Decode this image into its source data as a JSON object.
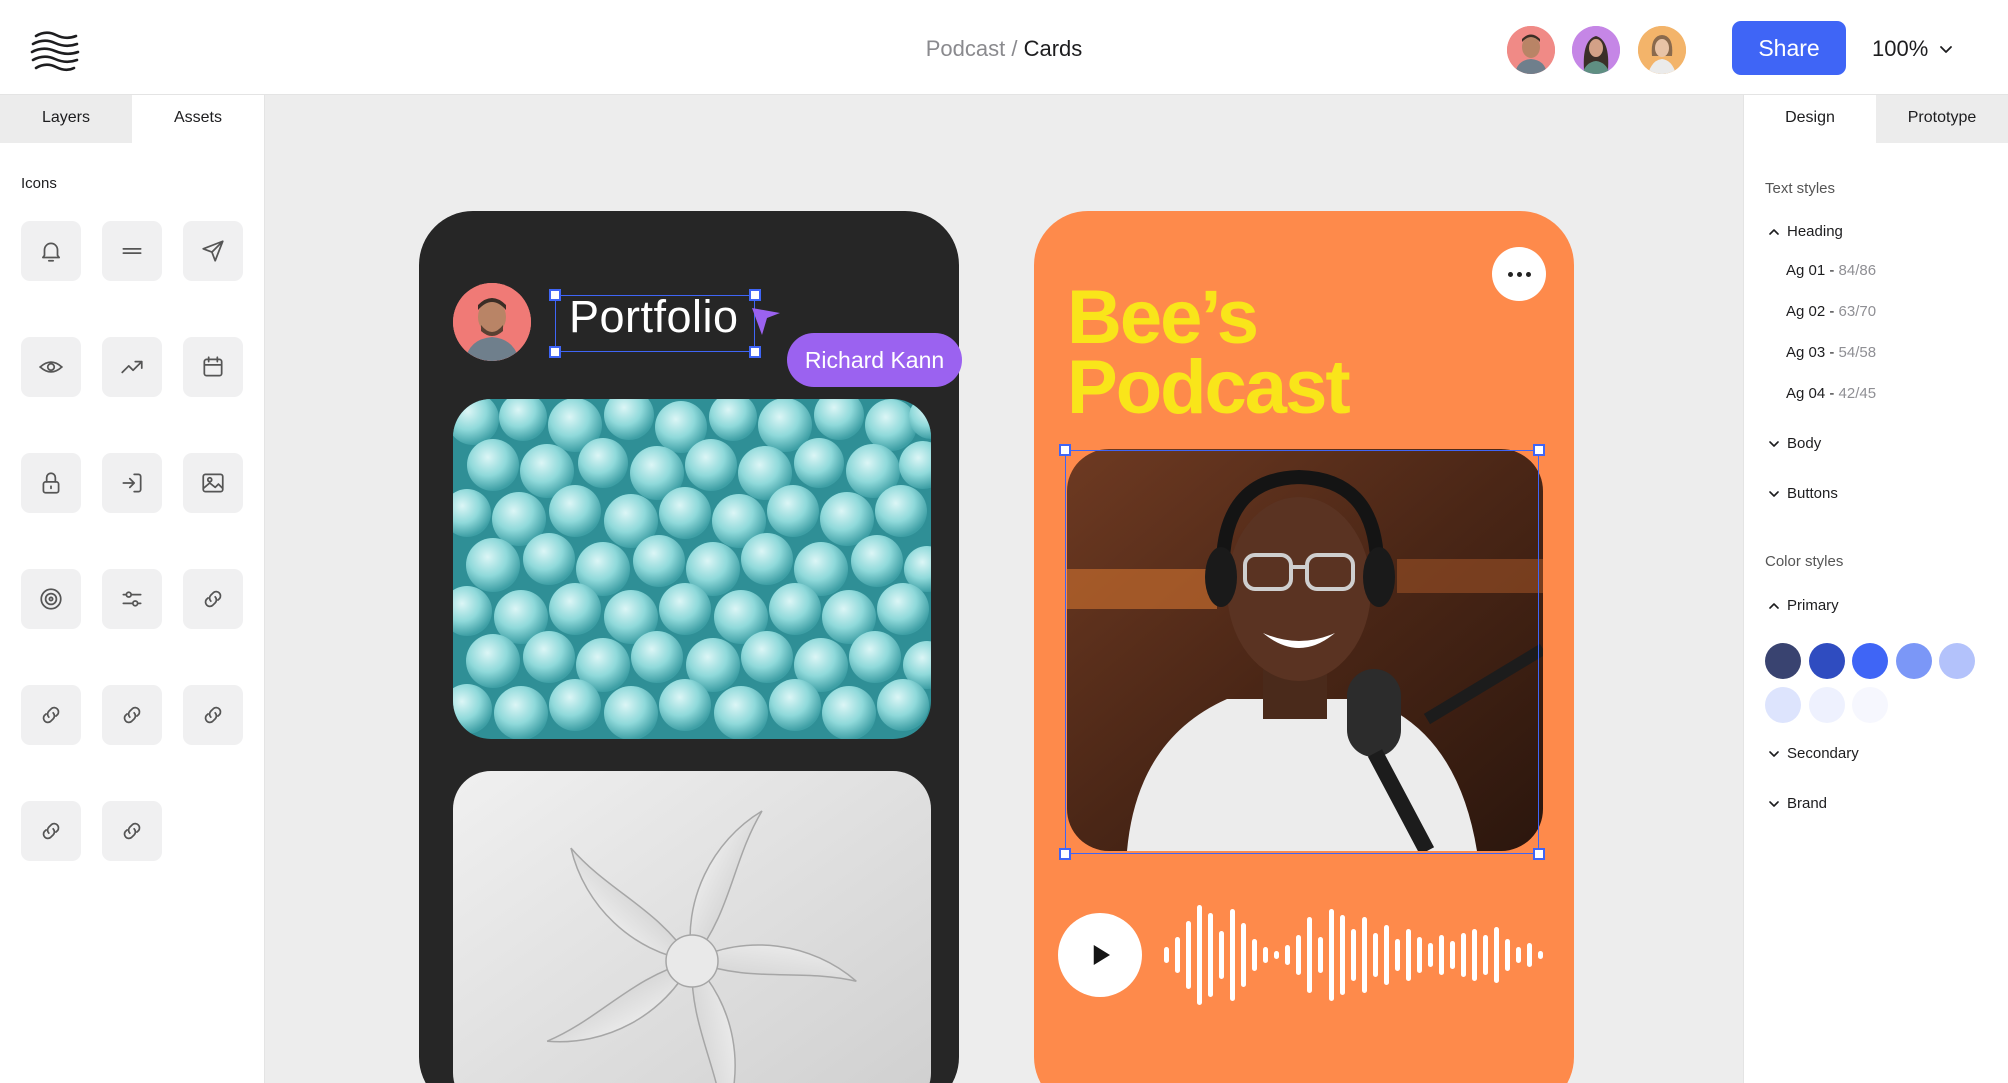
{
  "header": {
    "breadcrumb_parent": "Podcast",
    "breadcrumb_sep": " / ",
    "breadcrumb_current": "Cards",
    "share_label": "Share",
    "zoom_level": "100%"
  },
  "left_panel": {
    "tabs": [
      {
        "label": "Layers"
      },
      {
        "label": "Assets"
      }
    ],
    "active_tab": "Assets",
    "section_title": "Icons",
    "icons": [
      "bell-icon",
      "menu-icon",
      "send-icon",
      "eye-icon",
      "trending-up-icon",
      "calendar-icon",
      "lock-icon",
      "log-in-icon",
      "image-icon",
      "target-icon",
      "sliders-icon",
      "link-icon",
      "link-icon",
      "link-icon",
      "link-icon",
      "link-icon",
      "link-icon"
    ]
  },
  "right_panel": {
    "tabs": [
      {
        "label": "Design"
      },
      {
        "label": "Prototype"
      }
    ],
    "active_tab": "Design",
    "text_styles_title": "Text styles",
    "heading_group": "Heading",
    "heading_styles": [
      {
        "name": "Ag 01 - ",
        "meta": "84/86"
      },
      {
        "name": "Ag 02 - ",
        "meta": "63/70"
      },
      {
        "name": "Ag 03 - ",
        "meta": "54/58"
      },
      {
        "name": "Ag 04 - ",
        "meta": "42/45"
      }
    ],
    "body_group": "Body",
    "buttons_group": "Buttons",
    "color_styles_title": "Color styles",
    "primary_group": "Primary",
    "primary_colors": [
      "#394370",
      "#2f4cc0",
      "#3f65f6",
      "#7b97f7",
      "#b3c2fb",
      "#dde4fd",
      "#eef1fe",
      "#f6f7fe"
    ],
    "secondary_group": "Secondary",
    "brand_group": "Brand"
  },
  "canvas": {
    "portfolio_card": {
      "title": "Portfolio",
      "cursor_user": "Richard Kann"
    },
    "podcast_card": {
      "title_line1": "Bee’s",
      "title_line2": "Podcast"
    }
  },
  "colors": {
    "accent": "#3f65f6",
    "cursor": "#9b62f0",
    "podcast_bg": "#fe8a4b",
    "podcast_title": "#f9e51a",
    "portfolio_bg": "#262626"
  }
}
